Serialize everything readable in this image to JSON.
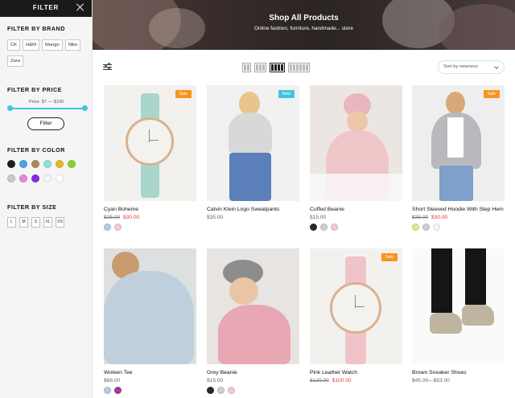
{
  "sidebar": {
    "title": "FILTER",
    "brand_title": "FILTER BY BRAND",
    "brands": [
      "CK",
      "H&M",
      "Mango",
      "Nike",
      "Zara"
    ],
    "price_title": "FILTER BY PRICE",
    "price_label": "Price: $7 — $100",
    "filter_button": "Filter",
    "color_title": "FILTER BY COLOR",
    "colors_row1": [
      "#1f1f1f",
      "#4aa3e0",
      "#b08a5a",
      "#8de0dc",
      "#e8b824",
      "#8bd12a"
    ],
    "colors_row2": [
      "#c9c9c9",
      "#e38ad8",
      "#8a2be2",
      "#f5f5f5",
      "#ffffff"
    ],
    "size_title": "FILTER BY SIZE",
    "sizes": [
      "L",
      "M",
      "S",
      "XL",
      "XS"
    ]
  },
  "hero": {
    "title": "Shop All Products",
    "subtitle": "Online fashion, furniture, handmade... store"
  },
  "toolbar": {
    "sort_label": "Sort by newness"
  },
  "products": [
    {
      "name": "Cyan Boheme",
      "old_price": "$35.00",
      "new_price": "$30.00",
      "badge": "Sale",
      "colors": [
        "#b7cce0",
        "#f6c6d9"
      ]
    },
    {
      "name": "Calvin Klein Logo Sweatpants",
      "price": "$35.00",
      "badge": "New",
      "colors": []
    },
    {
      "name": "Cuffed Beanie",
      "price": "$15.00",
      "colors": [
        "#2a2a2a",
        "#d0d0d0",
        "#f6c6d9"
      ]
    },
    {
      "name": "Short Sleeved Hoodie With Step Hem",
      "old_price": "$35.00",
      "new_price": "$30.00",
      "badge": "Sale",
      "colors": [
        "#d8ee8a",
        "#d0d0d0",
        "#f5f5f5"
      ]
    },
    {
      "name": "Woleen Tee",
      "price": "$68.00",
      "colors": [
        "#b7cce0",
        "#a23ca8"
      ]
    },
    {
      "name": "Grey Beanie",
      "price": "$15.00",
      "colors": [
        "#2a2a2a",
        "#d0d0d0",
        "#f6c6d9"
      ]
    },
    {
      "name": "Pink Leather Watch",
      "old_price": "$120.00",
      "new_price": "$100.00",
      "badge": "Sale",
      "colors": []
    },
    {
      "name": "Brown Sneaker Shoes",
      "price": "$45.00—$53.00",
      "colors": []
    }
  ],
  "accent_color": "#3fc4e0",
  "sale_color": "#f7941d",
  "new_color": "#3fc4e0"
}
